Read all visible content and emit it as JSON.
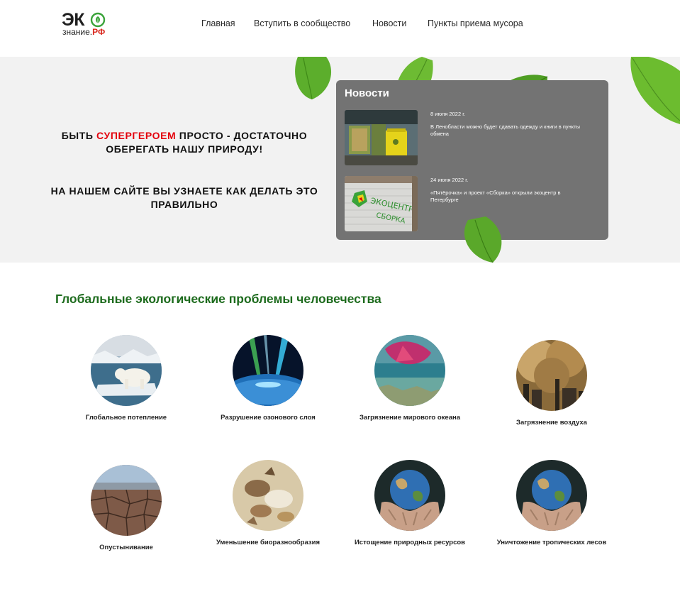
{
  "logo": {
    "main": "ЭК",
    "sub_prefix": "знание.",
    "sub_suffix": "РФ"
  },
  "nav": {
    "items": [
      {
        "label": "Главная"
      },
      {
        "label": "Вступить в сообщество"
      },
      {
        "label": "Новости"
      },
      {
        "label": "Пункты приема мусора"
      }
    ]
  },
  "hero": {
    "line1_pre": "Быть ",
    "line1_highlight": "супергероем",
    "line1_post": " просто - достаточно оберегать нашу природу!",
    "line2": "На нашем сайте вы узнаете как делать это правильно",
    "accent_color": "#e3000b"
  },
  "news": {
    "title": "Новости",
    "items": [
      {
        "date": "8 июля 2022 г.",
        "text": "В Ленобласти можно будет сдавать одежду и книги в пункты обмена",
        "image_icon": "recycling-bins-photo"
      },
      {
        "date": "24 июня 2022 г.",
        "text": "«Пятёрочка» и проект «Сборка» открыли экоцентр в Петербурге",
        "image_icon": "ecocenter-sign-photo"
      }
    ]
  },
  "problems": {
    "title": "Глобальные экологические проблемы человечества",
    "title_color": "#1d6b1d",
    "items": [
      {
        "label": "Глобальное потепление",
        "image_icon": "polar-bear-photo"
      },
      {
        "label": "Разрушение озонового слоя",
        "image_icon": "ozone-layer-photo"
      },
      {
        "label": "Загрязнение мирового океана",
        "image_icon": "ocean-pollution-photo"
      },
      {
        "label": "Загрязнение воздуха",
        "image_icon": "air-pollution-photo"
      },
      {
        "label": "Опустынивание",
        "image_icon": "cracked-earth-photo"
      },
      {
        "label": "Уменьшение биоразнообразия",
        "image_icon": "animals-photo"
      },
      {
        "label": "Истощение природных ресурсов",
        "image_icon": "earth-hands-photo"
      },
      {
        "label": "Уничтожение тропических лесов",
        "image_icon": "earth-hands-photo"
      }
    ]
  }
}
